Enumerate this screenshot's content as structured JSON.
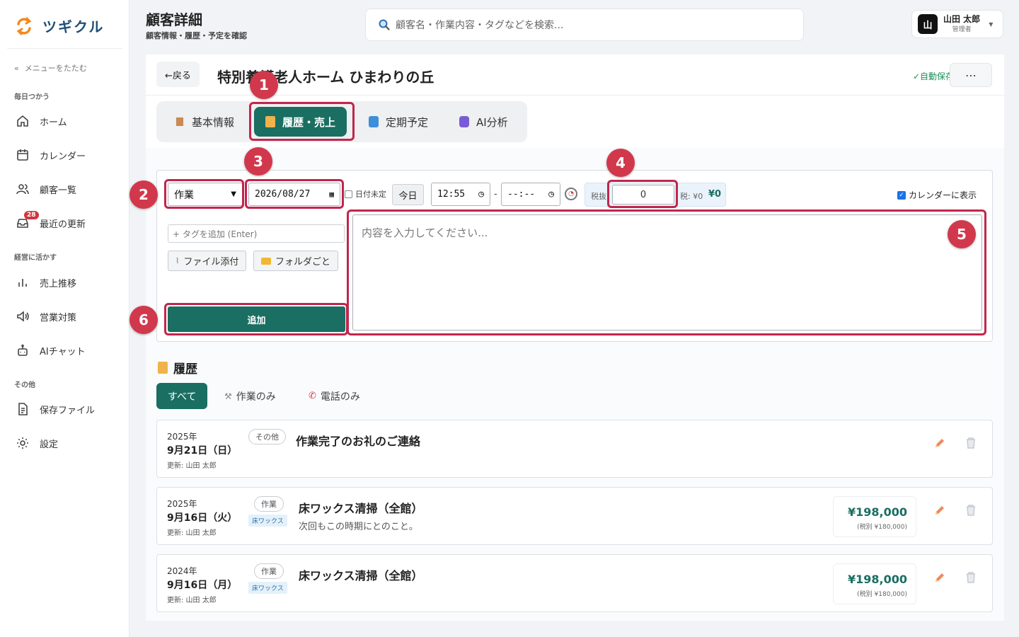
{
  "app": {
    "name": "ツギクル",
    "accent": "#1a6e62",
    "highlight": "#c0264c"
  },
  "sidebar": {
    "collapse_label": "メニューをたたむ",
    "sections": [
      {
        "label": "毎日つかう",
        "items": [
          {
            "label": "ホーム",
            "icon": "home-icon"
          },
          {
            "label": "カレンダー",
            "icon": "calendar-icon"
          },
          {
            "label": "顧客一覧",
            "icon": "users-icon"
          },
          {
            "label": "最近の更新",
            "icon": "inbox-icon",
            "badge": "28"
          }
        ]
      },
      {
        "label": "経営に活かす",
        "items": [
          {
            "label": "売上推移",
            "icon": "bar-chart-icon"
          },
          {
            "label": "営業対策",
            "icon": "megaphone-icon"
          },
          {
            "label": "AIチャット",
            "icon": "robot-icon"
          }
        ]
      },
      {
        "label": "その他",
        "items": [
          {
            "label": "保存ファイル",
            "icon": "file-icon"
          },
          {
            "label": "設定",
            "icon": "gear-icon"
          }
        ]
      }
    ]
  },
  "header": {
    "title": "顧客詳細",
    "subtitle": "顧客情報・履歴・予定を確認",
    "search_placeholder": "顧客名・作業内容・タグなどを検索...",
    "user": {
      "initial": "山",
      "name": "山田 太郎",
      "role": "管理者"
    }
  },
  "customer": {
    "back_label": "←戻る",
    "name": "特別養護老人ホーム ひまわりの丘",
    "autosave": "✓自動保存",
    "more": "⋯"
  },
  "tabs": [
    {
      "label": "基本情報",
      "active": false
    },
    {
      "label": "履歴・売上",
      "active": true
    },
    {
      "label": "定期予定",
      "active": false
    },
    {
      "label": "AI分析",
      "active": false
    }
  ],
  "form": {
    "type_value": "作業",
    "date_value": "2026/08/27",
    "date_undecided_label": "日付未定",
    "today_label": "今日",
    "time_start": "12:55",
    "time_sep": "-",
    "time_end": "--:--",
    "tax_excl_label": "税抜",
    "amount_value": "0",
    "tax_label": "税: ¥0",
    "total_label": "¥0",
    "calendar_label": "カレンダーに表示",
    "calendar_checked": true,
    "tag_placeholder": "+ タグを追加 (Enter)",
    "attach_label": "ファイル添付",
    "folder_label": "フォルダごと",
    "add_label": "追加",
    "content_placeholder": "内容を入力してください..."
  },
  "markers": [
    "1",
    "2",
    "3",
    "4",
    "5",
    "6"
  ],
  "history": {
    "title": "履歴",
    "filters": [
      {
        "label": "すべて",
        "active": true
      },
      {
        "label": "作業のみ",
        "active": false
      },
      {
        "label": "電話のみ",
        "active": false
      }
    ],
    "entries": [
      {
        "year": "2025年",
        "date": "9月21日（日）",
        "updated": "更新: 山田 太郎",
        "category": "その他",
        "tag": "",
        "title": "作業完了のお礼のご連絡",
        "note": "",
        "price": "",
        "price_sub": ""
      },
      {
        "year": "2025年",
        "date": "9月16日（火）",
        "updated": "更新: 山田 太郎",
        "category": "作業",
        "tag": "床ワックス",
        "title": "床ワックス清掃（全館）",
        "note": "次回もこの時期にとのこと。",
        "price": "¥198,000",
        "price_sub": "(税別 ¥180,000)"
      },
      {
        "year": "2024年",
        "date": "9月16日（月）",
        "updated": "更新: 山田 太郎",
        "category": "作業",
        "tag": "床ワックス",
        "title": "床ワックス清掃（全館）",
        "note": "",
        "price": "¥198,000",
        "price_sub": "(税別 ¥180,000)"
      }
    ]
  }
}
